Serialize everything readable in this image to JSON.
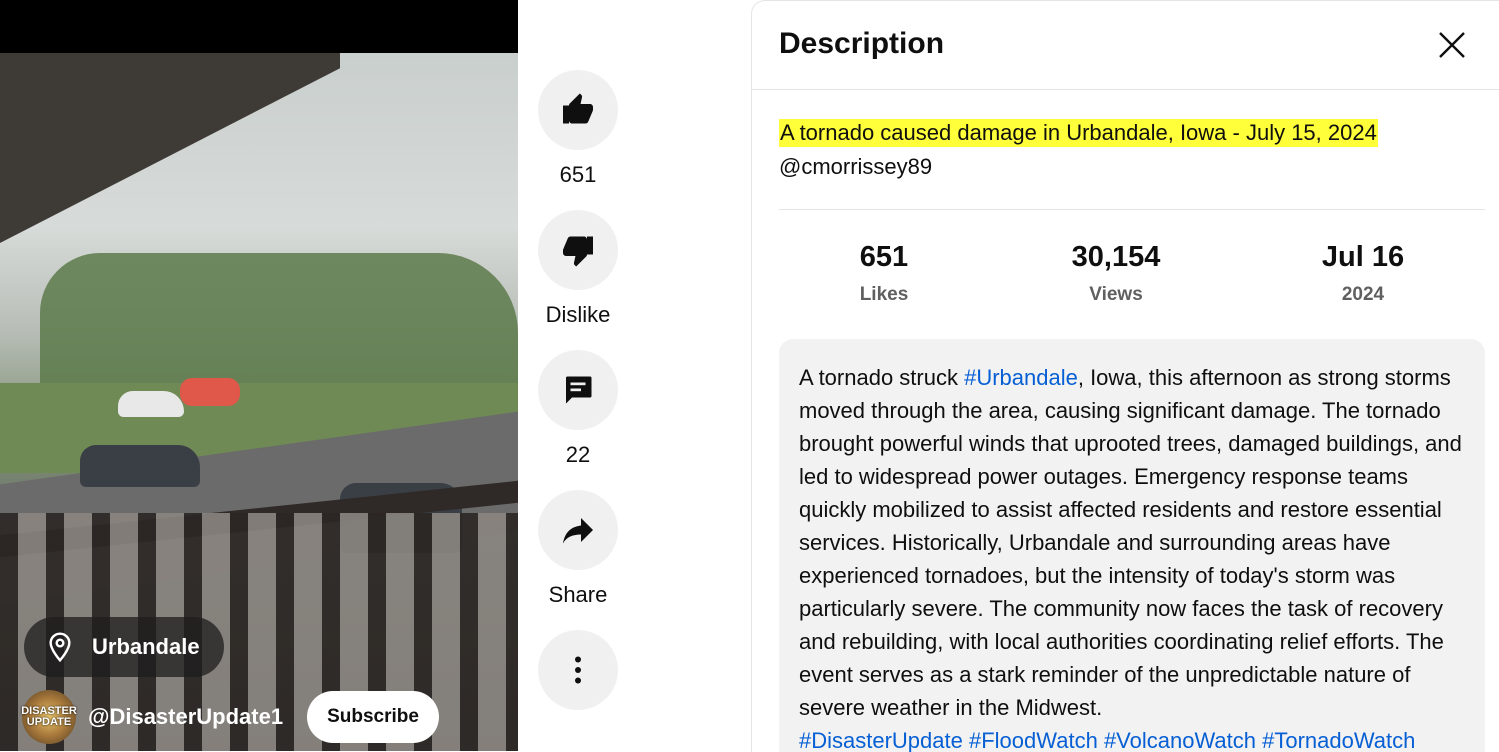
{
  "video": {
    "location": "Urbandale",
    "channel_name": "@DisasterUpdate1",
    "avatar_text": "DISASTER UPDATE",
    "subscribe_label": "Subscribe"
  },
  "actions": {
    "like_count": "651",
    "dislike_label": "Dislike",
    "comment_count": "22",
    "share_label": "Share"
  },
  "description_panel": {
    "title": "Description",
    "headline": "A tornado caused damage in Urbandale, Iowa - July 15, 2024",
    "handle": "@cmorrissey89",
    "stats": [
      {
        "value": "651",
        "label": "Likes"
      },
      {
        "value": "30,154",
        "label": "Views"
      },
      {
        "value": "Jul 16",
        "label": "2024"
      }
    ],
    "body": {
      "part1": "A tornado struck ",
      "tag1": "#Urbandale",
      "part2": ", Iowa, this afternoon as strong storms moved through the area, causing significant damage. The tornado brought powerful winds that uprooted trees, damaged buildings, and led to widespread power outages. Emergency response teams quickly mobilized to assist affected residents and restore essential services. Historically, Urbandale and surrounding areas have experienced tornadoes, but the intensity of today's storm was particularly severe. The community now faces the task of recovery and rebuilding, with local authorities coordinating relief efforts. The event serves as a stark reminder of the unpredictable nature of severe weather in the Midwest.",
      "hashtags": [
        "#DisasterUpdate",
        "#FloodWatch",
        "#VolcanoWatch",
        "#TornadoWatch"
      ]
    }
  },
  "colors": {
    "highlight": "#ffff3a",
    "link": "#065fd4",
    "action_bg": "#f0f0f0"
  }
}
